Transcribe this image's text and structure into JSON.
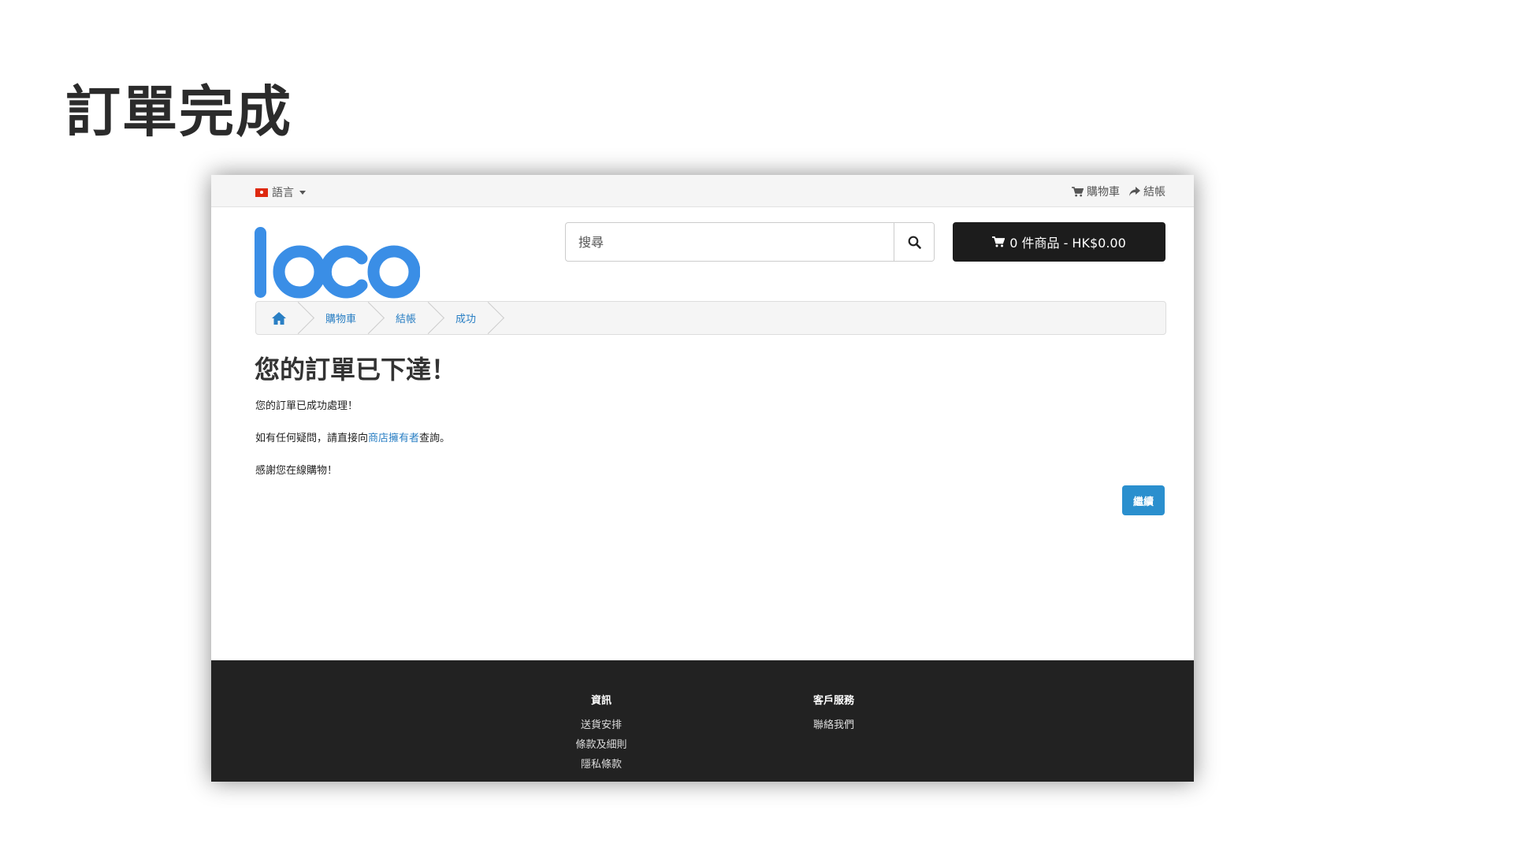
{
  "slide": {
    "title": "訂單完成"
  },
  "topbar": {
    "language_label": "語言",
    "cart_link": "購物車",
    "checkout_link": "結帳"
  },
  "header": {
    "logo_text": "loco",
    "search_placeholder": "搜尋",
    "cart_summary": "0 件商品 - HK$0.00"
  },
  "breadcrumb": {
    "items": [
      "購物車",
      "結帳",
      "成功"
    ]
  },
  "content": {
    "heading": "您的訂單已下達！",
    "line1": "您的訂單已成功處理！",
    "line2_prefix": "如有任何疑問，請直接向",
    "line2_link": "商店擁有者",
    "line2_suffix": "查詢。",
    "line3": "感謝您在線購物！",
    "continue_label": "繼續"
  },
  "footer": {
    "col1": {
      "title": "資訊",
      "links": [
        "送貨安排",
        "條款及細則",
        "隱私條款"
      ]
    },
    "col2": {
      "title": "客戶服務",
      "links": [
        "聯絡我們"
      ]
    }
  },
  "colors": {
    "brand_blue": "#3a8ee6",
    "link_blue": "#2a7fc4",
    "button_blue": "#2a8fce",
    "dark": "#1c1c1c",
    "footer": "#222222"
  }
}
